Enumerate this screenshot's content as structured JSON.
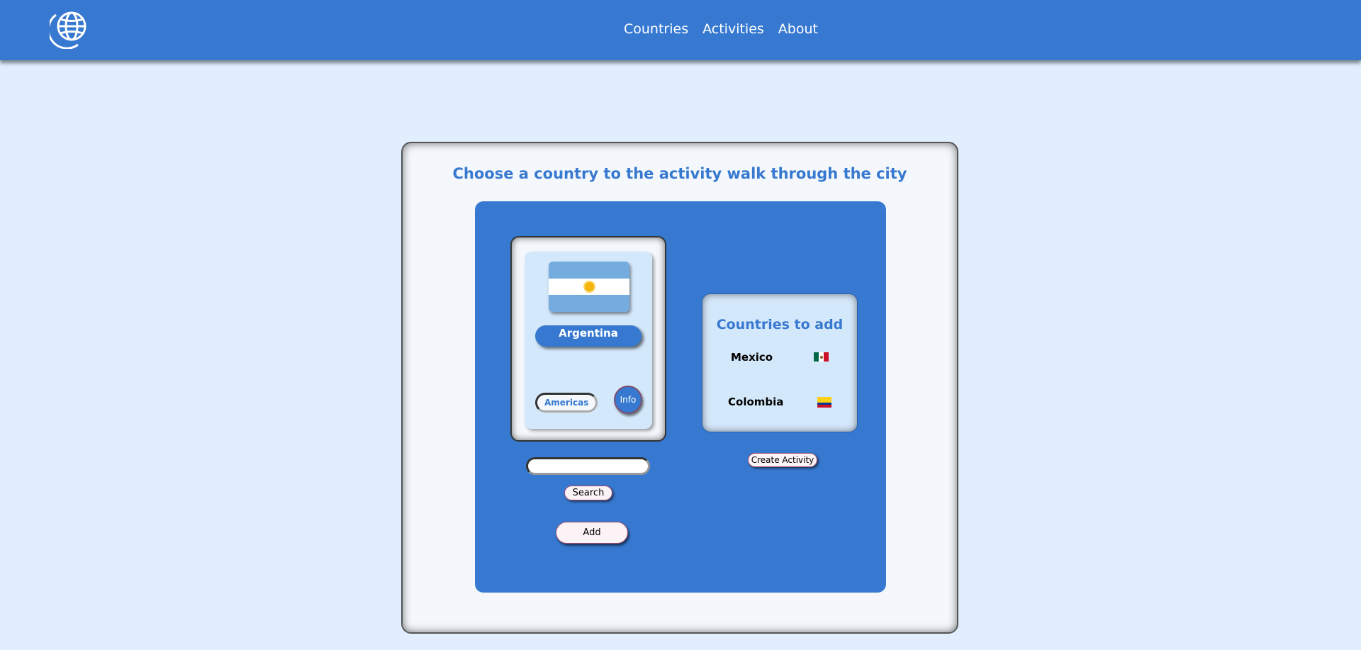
{
  "navbar": {
    "logo_icon": "globe-icon",
    "links": [
      {
        "label": "Countries"
      },
      {
        "label": "Activities"
      },
      {
        "label": "About"
      }
    ]
  },
  "main": {
    "title": "Choose a country to the activity walk through the city"
  },
  "country_card": {
    "flag_icon": "argentina-flag-icon",
    "name": "Argentina",
    "continent": "Americas",
    "info_label": "Info"
  },
  "search": {
    "value": "",
    "placeholder": "",
    "button_label": "Search"
  },
  "add_button_label": "Add",
  "countries_to_add": {
    "title": "Countries to add",
    "items": [
      {
        "name": "Mexico",
        "flag_icon": "mexico-flag-icon"
      },
      {
        "name": "Colombia",
        "flag_icon": "colombia-flag-icon"
      }
    ]
  },
  "create_activity_label": "Create Activity",
  "colors": {
    "primary": "#3779d0",
    "page_background": "#e1eefe",
    "card_background": "#d4e8fb",
    "panel_background": "#f4f8fc"
  }
}
